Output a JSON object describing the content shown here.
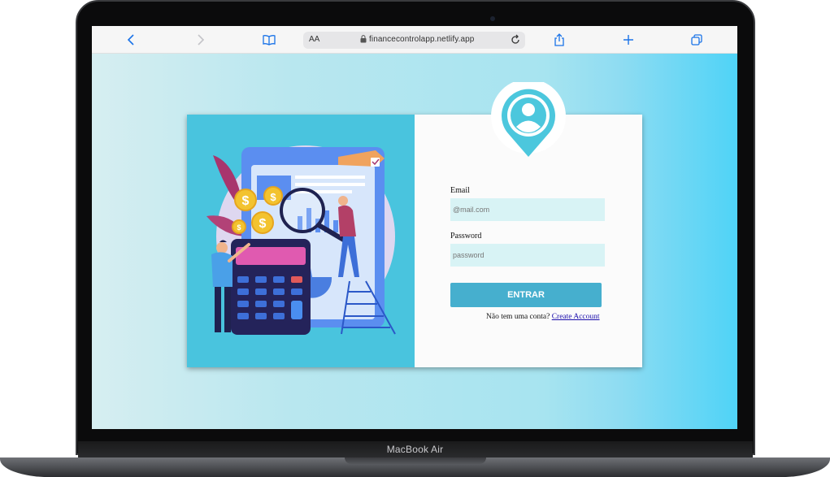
{
  "device": {
    "label": "MacBook Air"
  },
  "browser": {
    "text_size_label": "AA",
    "url": "financecontrolapp.netlify.app",
    "icons": {
      "back": "chevron-left-icon",
      "forward": "chevron-right-icon",
      "bookmarks": "book-icon",
      "lock": "lock-icon",
      "reload": "reload-icon",
      "share": "share-icon",
      "new_tab": "plus-icon",
      "tabs": "tabs-icon"
    }
  },
  "login": {
    "email_label": "Email",
    "email_placeholder": "@mail.com",
    "password_label": "Password",
    "password_placeholder": "password",
    "submit_label": "ENTRAR",
    "no_account_text": "Não tem uma conta?",
    "create_account_link": "Create Account"
  },
  "colors": {
    "accent": "#46afce",
    "illustration_bg": "#49c4de",
    "input_bg": "#d8f3f5",
    "toolbar_icon": "#1a73e8"
  }
}
